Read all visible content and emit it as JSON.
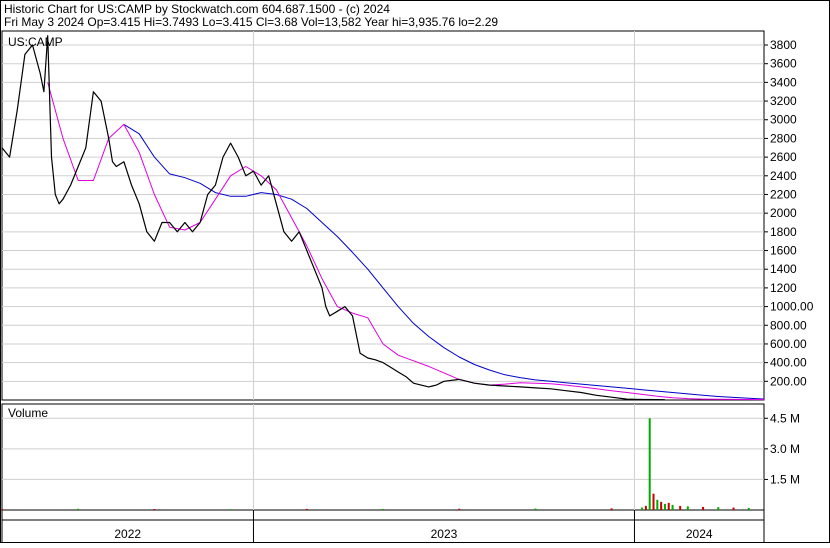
{
  "header": {
    "line1": "Historic Chart for US:CAMP by Stockwatch.com 604.687.1500 - (c) 2024",
    "line2": "Fri May  3 2024  Op=3.415  Hi=3.7493  Lo=3.415  Cl=3.68  Vol=13,582  Year hi=3,935.76  lo=2.29"
  },
  "colors": {
    "price": "#000000",
    "ma_short": "#e000e0",
    "ma_long": "#0000cc",
    "volume_up": "#00aa00",
    "volume_down": "#cc0000",
    "grid": "#cfcfcf",
    "frame": "#000000"
  },
  "chart_data": [
    {
      "type": "line",
      "name": "price-panel",
      "label": "US:CAMP",
      "ylim": [
        0,
        3950
      ],
      "yticks": [
        200,
        400,
        600,
        800,
        1000,
        1200,
        1400,
        1600,
        1800,
        2000,
        2200,
        2400,
        2600,
        2800,
        3000,
        3200,
        3400,
        3600,
        3800
      ],
      "ytick_labels": [
        "200.00",
        "400.00",
        "600.00",
        "800.00",
        "1000.00",
        "1200",
        "1400",
        "1600",
        "1800",
        "2000",
        "2200",
        "2400",
        "2600",
        "2800",
        "3000",
        "3200",
        "3400",
        "3600",
        "3800"
      ],
      "grid": true,
      "x_domain": [
        0,
        1.0
      ],
      "x_period_labels": [
        "2022",
        "2023",
        "2024"
      ],
      "x_period_bounds": [
        0.0,
        0.33,
        0.83,
        1.0
      ],
      "series": [
        {
          "name": "",
          "role": "close",
          "x": [
            0.0,
            0.01,
            0.02,
            0.03,
            0.04,
            0.05,
            0.055,
            0.06,
            0.065,
            0.07,
            0.075,
            0.08,
            0.09,
            0.1,
            0.11,
            0.12,
            0.13,
            0.14,
            0.145,
            0.15,
            0.16,
            0.17,
            0.18,
            0.19,
            0.2,
            0.21,
            0.22,
            0.23,
            0.24,
            0.25,
            0.26,
            0.27,
            0.28,
            0.29,
            0.3,
            0.31,
            0.32,
            0.33,
            0.34,
            0.35,
            0.36,
            0.37,
            0.38,
            0.39,
            0.4,
            0.41,
            0.42,
            0.425,
            0.43,
            0.44,
            0.45,
            0.46,
            0.47,
            0.48,
            0.49,
            0.5,
            0.51,
            0.52,
            0.53,
            0.54,
            0.55,
            0.56,
            0.565,
            0.57,
            0.575,
            0.58,
            0.6,
            0.62,
            0.64,
            0.66,
            0.68,
            0.7,
            0.72,
            0.74,
            0.76,
            0.78,
            0.8,
            0.82,
            0.84,
            0.86,
            0.87
          ],
          "values": [
            2700,
            2600,
            3100,
            3700,
            3800,
            3500,
            3300,
            3900,
            2600,
            2200,
            2100,
            2150,
            2300,
            2500,
            2700,
            3300,
            3200,
            2800,
            2550,
            2500,
            2550,
            2300,
            2100,
            1800,
            1700,
            1900,
            1900,
            1800,
            1900,
            1800,
            1900,
            2200,
            2300,
            2600,
            2750,
            2600,
            2400,
            2450,
            2300,
            2400,
            2100,
            1800,
            1700,
            1800,
            1600,
            1400,
            1200,
            1000,
            900,
            950,
            1000,
            900,
            500,
            450,
            430,
            400,
            350,
            300,
            250,
            180,
            160,
            140,
            150,
            160,
            180,
            200,
            220,
            180,
            160,
            150,
            140,
            130,
            120,
            100,
            80,
            50,
            30,
            10,
            5,
            4,
            3.68
          ]
        },
        {
          "name": "",
          "role": "moving-average-short",
          "x": [
            0.06,
            0.08,
            0.1,
            0.12,
            0.14,
            0.16,
            0.18,
            0.2,
            0.22,
            0.24,
            0.26,
            0.28,
            0.3,
            0.32,
            0.34,
            0.36,
            0.38,
            0.4,
            0.42,
            0.44,
            0.46,
            0.48,
            0.5,
            0.52,
            0.54,
            0.56,
            0.58,
            0.6,
            0.62,
            0.64,
            0.66,
            0.68,
            0.7,
            0.72,
            0.74,
            0.76,
            0.78,
            0.8,
            0.82,
            0.84,
            0.86,
            0.88,
            0.9,
            0.92,
            0.94,
            0.96,
            0.98,
            1.0
          ],
          "values": [
            3400,
            2800,
            2350,
            2350,
            2800,
            2950,
            2650,
            2200,
            1850,
            1820,
            1900,
            2150,
            2400,
            2500,
            2400,
            2250,
            1950,
            1650,
            1300,
            1000,
            930,
            880,
            600,
            480,
            420,
            360,
            290,
            220,
            180,
            160,
            170,
            185,
            180,
            175,
            160,
            140,
            120,
            100,
            80,
            60,
            40,
            25,
            15,
            10,
            8,
            6,
            5,
            4
          ]
        },
        {
          "name": "",
          "role": "moving-average-long",
          "x": [
            0.16,
            0.18,
            0.2,
            0.22,
            0.24,
            0.26,
            0.28,
            0.3,
            0.32,
            0.34,
            0.36,
            0.38,
            0.4,
            0.42,
            0.44,
            0.46,
            0.48,
            0.5,
            0.52,
            0.54,
            0.56,
            0.58,
            0.6,
            0.62,
            0.64,
            0.66,
            0.68,
            0.7,
            0.72,
            0.74,
            0.76,
            0.78,
            0.8,
            0.82,
            0.84,
            0.86,
            0.88,
            0.9,
            0.92,
            0.94,
            0.96,
            0.98,
            1.0
          ],
          "values": [
            2950,
            2850,
            2600,
            2420,
            2380,
            2320,
            2220,
            2180,
            2180,
            2220,
            2200,
            2150,
            2050,
            1900,
            1750,
            1580,
            1400,
            1200,
            1000,
            820,
            680,
            560,
            460,
            380,
            320,
            270,
            240,
            215,
            200,
            185,
            170,
            155,
            140,
            125,
            110,
            95,
            80,
            65,
            50,
            38,
            28,
            18,
            10
          ]
        }
      ]
    },
    {
      "type": "bar",
      "name": "volume-panel",
      "label": "Volume",
      "ylim": [
        0,
        5200000
      ],
      "yticks": [
        1500000,
        3000000,
        4500000
      ],
      "ytick_labels": [
        "1.5 M",
        "3.0 M",
        "4.5 M"
      ],
      "x": [
        0.0,
        0.1,
        0.2,
        0.3,
        0.4,
        0.5,
        0.6,
        0.7,
        0.8,
        0.84,
        0.845,
        0.85,
        0.855,
        0.86,
        0.865,
        0.87,
        0.875,
        0.88,
        0.89,
        0.9,
        0.92,
        0.94,
        0.96,
        0.98
      ],
      "values": [
        40000,
        60000,
        50000,
        45000,
        55000,
        50000,
        60000,
        70000,
        80000,
        120000,
        200000,
        4500000,
        800000,
        500000,
        400000,
        300000,
        350000,
        250000,
        200000,
        180000,
        150000,
        140000,
        120000,
        100000
      ]
    }
  ]
}
